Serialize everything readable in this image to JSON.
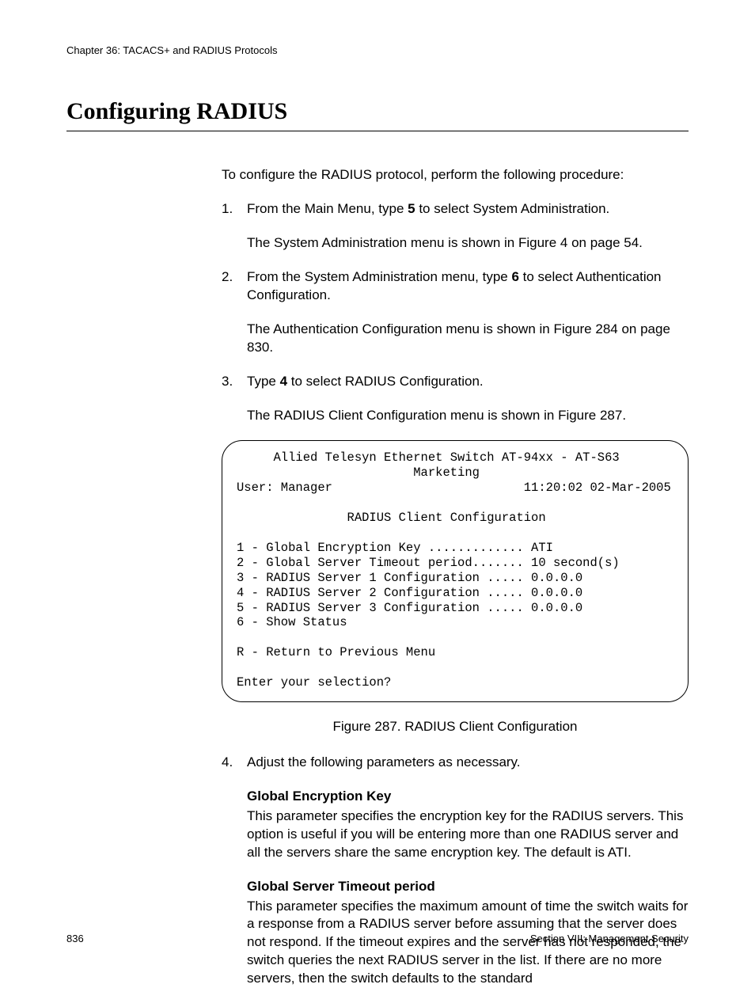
{
  "header": {
    "chapter": "Chapter 36: TACACS+ and RADIUS Protocols"
  },
  "title": "Configuring RADIUS",
  "intro": "To configure the RADIUS protocol, perform the following procedure:",
  "steps": {
    "s1": {
      "num": "1.",
      "pre": "From the Main Menu, type ",
      "bold": "5",
      "post": " to select System Administration.",
      "sub": "The System Administration menu is shown in Figure 4 on page 54."
    },
    "s2": {
      "num": "2.",
      "pre": "From the System Administration menu, type ",
      "bold": "6",
      "post": " to select Authentication Configuration.",
      "sub": "The Authentication Configuration menu is shown in Figure 284 on page 830."
    },
    "s3": {
      "num": "3.",
      "pre": "Type ",
      "bold": "4",
      "post": " to select RADIUS Configuration.",
      "sub": "The RADIUS Client Configuration menu is shown in Figure 287."
    },
    "s4": {
      "num": "4.",
      "text": "Adjust the following parameters as necessary."
    }
  },
  "terminal": "     Allied Telesyn Ethernet Switch AT-94xx - AT-S63\n                        Marketing\nUser: Manager                          11:20:02 02-Mar-2005\n\n               RADIUS Client Configuration\n\n1 - Global Encryption Key ............. ATI\n2 - Global Server Timeout period....... 10 second(s)\n3 - RADIUS Server 1 Configuration ..... 0.0.0.0\n4 - RADIUS Server 2 Configuration ..... 0.0.0.0\n5 - RADIUS Server 3 Configuration ..... 0.0.0.0\n6 - Show Status\n\nR - Return to Previous Menu\n\nEnter your selection?",
  "figure_caption": "Figure 287. RADIUS Client Configuration",
  "params": {
    "p1": {
      "label": "Global Encryption Key",
      "desc": "This parameter specifies the encryption key for the RADIUS servers. This option is useful if you will be entering more than one RADIUS server and all the servers share the same encryption key. The default is ATI."
    },
    "p2": {
      "label": "Global Server Timeout period",
      "desc": "This parameter specifies the maximum amount of time the switch waits for a response from a RADIUS server before assuming that the server does not respond. If the timeout expires and the server has not responded, the switch queries the next RADIUS server in the list. If there are no more servers, then the switch defaults to the standard"
    }
  },
  "footer": {
    "page": "836",
    "section": "Section VIII: Management Security"
  }
}
